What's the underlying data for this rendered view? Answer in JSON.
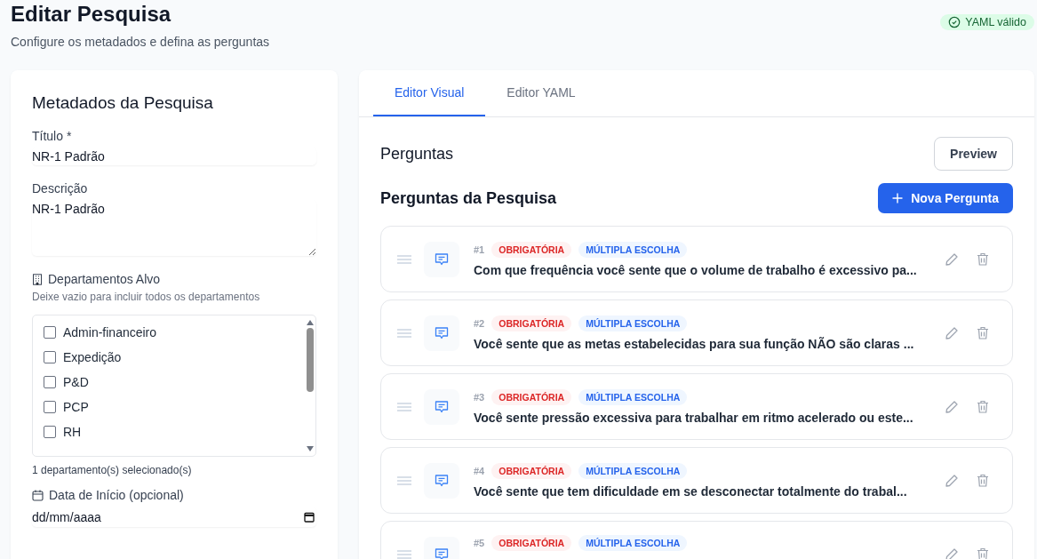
{
  "header": {
    "title": "Editar Pesquisa",
    "subtitle": "Configure os metadados e defina as perguntas",
    "yaml_status": {
      "label": "YAML válido",
      "valid": true
    }
  },
  "metadata": {
    "heading": "Metadados da Pesquisa",
    "title_field": {
      "label": "Título *",
      "value": "NR-1 Padrão"
    },
    "description_field": {
      "label": "Descrição",
      "value": "NR-1 Padrão"
    },
    "departments": {
      "label": "Departamentos Alvo",
      "hint": "Deixe vazio para incluir todos os departamentos",
      "items": [
        {
          "name": "Admin-financeiro",
          "checked": false
        },
        {
          "name": "Expedição",
          "checked": false
        },
        {
          "name": "P&D",
          "checked": false
        },
        {
          "name": "PCP",
          "checked": false
        },
        {
          "name": "RH",
          "checked": false
        }
      ],
      "count": "1 departamento(s) selecionado(s)"
    },
    "start_date": {
      "label": "Data de Início (opcional)",
      "placeholder": "dd/mm/aaaa"
    }
  },
  "tabs": [
    {
      "label": "Editor Visual",
      "selected": true
    },
    {
      "label": "Editor YAML",
      "selected": false
    }
  ],
  "questions_section": {
    "heading": "Perguntas",
    "preview_button": "Preview",
    "list_heading": "Perguntas da Pesquisa",
    "add_button": "Nova Pergunta"
  },
  "questions": [
    {
      "number": "#1",
      "required": true,
      "required_label": "OBRIGATÓRIA",
      "type_label": "MÚLTIPLA ESCOLHA",
      "text": "Com que frequência você sente que o volume de trabalho é excessivo pa..."
    },
    {
      "number": "#2",
      "required": true,
      "required_label": "OBRIGATÓRIA",
      "type_label": "MÚLTIPLA ESCOLHA",
      "text": "Você sente que as metas estabelecidas para sua função NÃO são claras ..."
    },
    {
      "number": "#3",
      "required": true,
      "required_label": "OBRIGATÓRIA",
      "type_label": "MÚLTIPLA ESCOLHA",
      "text": "Você sente pressão excessiva para trabalhar em ritmo acelerado ou este..."
    },
    {
      "number": "#4",
      "required": true,
      "required_label": "OBRIGATÓRIA",
      "type_label": "MÚLTIPLA ESCOLHA",
      "text": "Você sente que tem dificuldade em se desconectar totalmente do trabal..."
    },
    {
      "number": "#5",
      "required": true,
      "required_label": "OBRIGATÓRIA",
      "type_label": "MÚLTIPLA ESCOLHA"
    }
  ]
}
